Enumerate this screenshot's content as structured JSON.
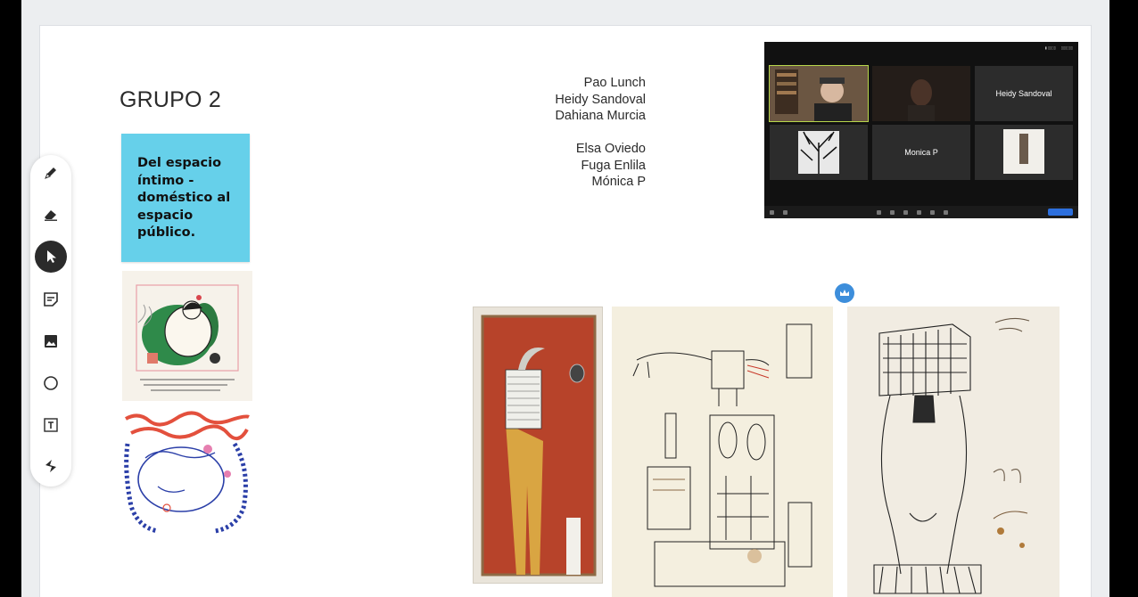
{
  "board": {
    "group_title": "GRUPO 2",
    "sticky_note": "Del espacio\níntimo -\ndoméstico al\nespacio\npúblico.",
    "names_a": [
      "Pao Lunch",
      "Heidy Sandoval",
      "Dahiana Murcia"
    ],
    "names_b": [
      "Elsa Oviedo",
      "Fuga Enlila",
      "Mónica P"
    ]
  },
  "toolbar": {
    "tools": [
      "pen-icon",
      "eraser-icon",
      "select-icon",
      "sticky-note-icon",
      "image-icon",
      "shape-icon",
      "text-icon",
      "more-tools-icon"
    ],
    "active": "select-icon"
  },
  "zoom_call": {
    "tiles": [
      "",
      "",
      "Heidy Sandoval",
      "",
      "Monica P",
      ""
    ]
  },
  "colors": {
    "sticky": "#66d0ea",
    "board": "#ffffff",
    "accent": "#3d8edb"
  }
}
